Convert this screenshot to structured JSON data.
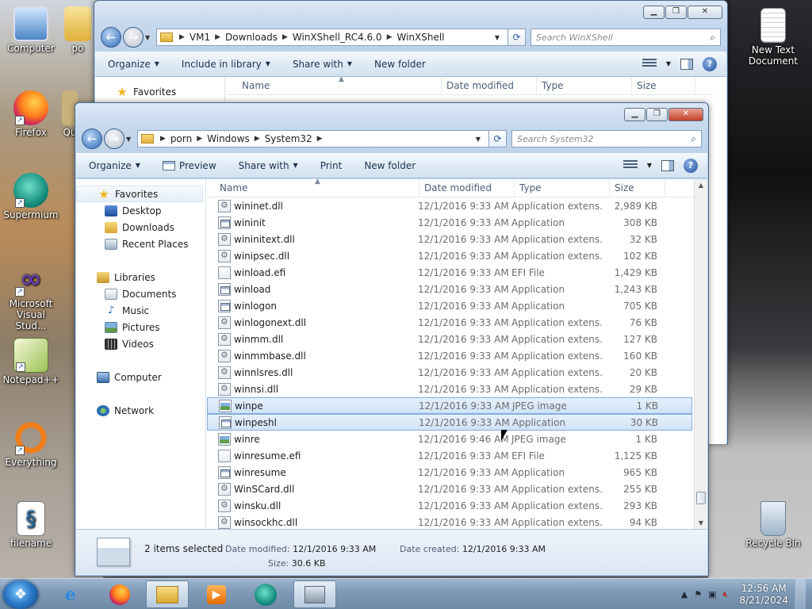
{
  "desktop": {
    "icons": [
      {
        "label": "Computer",
        "icon": "computer-icon"
      },
      {
        "label": "po",
        "icon": "folder-icon"
      },
      {
        "label": "Firefox",
        "icon": "firefox-icon"
      },
      {
        "label": "Qu",
        "icon": "app-icon"
      },
      {
        "label": "Supermium",
        "icon": "supermium-icon"
      },
      {
        "label": "Microsoft Visual Stud...",
        "icon": "visual-studio-icon"
      },
      {
        "label": "Notepad++",
        "icon": "notepadpp-icon"
      },
      {
        "label": "Everything",
        "icon": "everything-icon"
      },
      {
        "label": "filename",
        "icon": "script-file-icon"
      },
      {
        "label": "New Text Document",
        "icon": "text-document-icon"
      },
      {
        "label": "Recycle Bin",
        "icon": "recycle-bin-icon"
      }
    ]
  },
  "back_window": {
    "breadcrumb": [
      "VM1",
      "Downloads",
      "WinXShell_RC4.6.0",
      "WinXShell"
    ],
    "search_placeholder": "Search WinXShell",
    "toolbar": {
      "organize": "Organize",
      "include": "Include in library",
      "share": "Share with",
      "new_folder": "New folder"
    },
    "nav_first": "Favorites",
    "columns": {
      "name": "Name",
      "date": "Date modified",
      "type": "Type",
      "size": "Size"
    }
  },
  "front_window": {
    "breadcrumb": [
      "porn",
      "Windows",
      "System32"
    ],
    "search_placeholder": "Search System32",
    "toolbar": {
      "organize": "Organize",
      "preview": "Preview",
      "share": "Share with",
      "print": "Print",
      "new_folder": "New folder"
    },
    "nav": {
      "favorites": "Favorites",
      "desktop": "Desktop",
      "downloads": "Downloads",
      "recent": "Recent Places",
      "libraries": "Libraries",
      "documents": "Documents",
      "music": "Music",
      "pictures": "Pictures",
      "videos": "Videos",
      "computer": "Computer",
      "network": "Network"
    },
    "columns": {
      "name": "Name",
      "date": "Date modified",
      "type": "Type",
      "size": "Size"
    },
    "files": [
      {
        "name": "wininet.dll",
        "date": "12/1/2016 9:33 AM",
        "type": "Application extens...",
        "size": "2,989 KB",
        "kind": "dll"
      },
      {
        "name": "wininit",
        "date": "12/1/2016 9:33 AM",
        "type": "Application",
        "size": "308 KB",
        "kind": "app"
      },
      {
        "name": "wininitext.dll",
        "date": "12/1/2016 9:33 AM",
        "type": "Application extens...",
        "size": "32 KB",
        "kind": "dll"
      },
      {
        "name": "winipsec.dll",
        "date": "12/1/2016 9:33 AM",
        "type": "Application extens...",
        "size": "102 KB",
        "kind": "dll"
      },
      {
        "name": "winload.efi",
        "date": "12/1/2016 9:33 AM",
        "type": "EFI File",
        "size": "1,429 KB",
        "kind": "file"
      },
      {
        "name": "winload",
        "date": "12/1/2016 9:33 AM",
        "type": "Application",
        "size": "1,243 KB",
        "kind": "app"
      },
      {
        "name": "winlogon",
        "date": "12/1/2016 9:33 AM",
        "type": "Application",
        "size": "705 KB",
        "kind": "app"
      },
      {
        "name": "winlogonext.dll",
        "date": "12/1/2016 9:33 AM",
        "type": "Application extens...",
        "size": "76 KB",
        "kind": "dll"
      },
      {
        "name": "winmm.dll",
        "date": "12/1/2016 9:33 AM",
        "type": "Application extens...",
        "size": "127 KB",
        "kind": "dll"
      },
      {
        "name": "winmmbase.dll",
        "date": "12/1/2016 9:33 AM",
        "type": "Application extens...",
        "size": "160 KB",
        "kind": "dll"
      },
      {
        "name": "winnlsres.dll",
        "date": "12/1/2016 9:33 AM",
        "type": "Application extens...",
        "size": "20 KB",
        "kind": "dll"
      },
      {
        "name": "winnsi.dll",
        "date": "12/1/2016 9:33 AM",
        "type": "Application extens...",
        "size": "29 KB",
        "kind": "dll"
      },
      {
        "name": "winpe",
        "date": "12/1/2016 9:33 AM",
        "type": "JPEG image",
        "size": "1 KB",
        "kind": "img",
        "selected": true
      },
      {
        "name": "winpeshl",
        "date": "12/1/2016 9:33 AM",
        "type": "Application",
        "size": "30 KB",
        "kind": "app",
        "selected": true
      },
      {
        "name": "winre",
        "date": "12/1/2016 9:46 AM",
        "type": "JPEG image",
        "size": "1 KB",
        "kind": "img"
      },
      {
        "name": "winresume.efi",
        "date": "12/1/2016 9:33 AM",
        "type": "EFI File",
        "size": "1,125 KB",
        "kind": "file"
      },
      {
        "name": "winresume",
        "date": "12/1/2016 9:33 AM",
        "type": "Application",
        "size": "965 KB",
        "kind": "app"
      },
      {
        "name": "WinSCard.dll",
        "date": "12/1/2016 9:33 AM",
        "type": "Application extens...",
        "size": "255 KB",
        "kind": "dll"
      },
      {
        "name": "winsku.dll",
        "date": "12/1/2016 9:33 AM",
        "type": "Application extens...",
        "size": "293 KB",
        "kind": "dll"
      },
      {
        "name": "winsockhc.dll",
        "date": "12/1/2016 9:33 AM",
        "type": "Application extens...",
        "size": "94 KB",
        "kind": "dll"
      }
    ],
    "details": {
      "selection": "2 items selected",
      "modified_label": "Date modified:",
      "modified_value": "12/1/2016 9:33 AM",
      "created_label": "Date created:",
      "created_value": "12/1/2016 9:33 AM",
      "size_label": "Size:",
      "size_value": "30.6 KB"
    }
  },
  "taskbar": {
    "time": "12:56 AM",
    "date": "8/21/2024"
  }
}
